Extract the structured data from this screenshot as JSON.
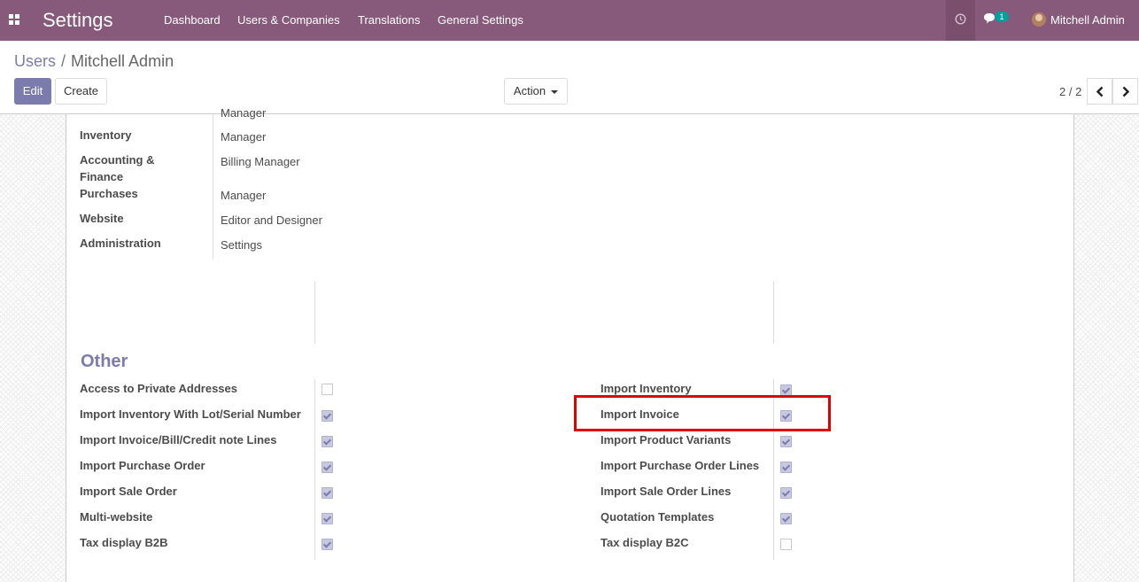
{
  "navbar": {
    "app_title": "Settings",
    "menu": [
      "Dashboard",
      "Users & Companies",
      "Translations",
      "General Settings"
    ],
    "chat_badge": "1",
    "user_name": "Mitchell Admin"
  },
  "control_panel": {
    "breadcrumb_parent": "Users",
    "breadcrumb_sep": "/",
    "breadcrumb_current": "Mitchell Admin",
    "edit_label": "Edit",
    "create_label": "Create",
    "action_label": "Action",
    "pager": "2 / 2"
  },
  "access_rights": {
    "cut_off_value": "Manager",
    "rows": [
      {
        "label": "Inventory",
        "value": "Manager"
      },
      {
        "label": "Accounting & Finance",
        "value": "Billing Manager"
      },
      {
        "label": "Purchases",
        "value": "Manager"
      },
      {
        "label": "Website",
        "value": "Editor and Designer"
      },
      {
        "label": "Administration",
        "value": "Settings"
      }
    ]
  },
  "other": {
    "title": "Other",
    "left": [
      {
        "label": "Access to Private Addresses",
        "checked": false
      },
      {
        "label": "Import Inventory With Lot/Serial Number",
        "checked": true
      },
      {
        "label": "Import Invoice/Bill/Credit note Lines",
        "checked": true
      },
      {
        "label": "Import Purchase Order",
        "checked": true
      },
      {
        "label": "Import Sale Order",
        "checked": true
      },
      {
        "label": "Multi-website",
        "checked": true
      },
      {
        "label": "Tax display B2B",
        "checked": true
      }
    ],
    "right": [
      {
        "label": "Import Inventory",
        "checked": true
      },
      {
        "label": "Import Invoice",
        "checked": true
      },
      {
        "label": "Import Product Variants",
        "checked": true
      },
      {
        "label": "Import Purchase Order Lines",
        "checked": true
      },
      {
        "label": "Import Sale Order Lines",
        "checked": true
      },
      {
        "label": "Quotation Templates",
        "checked": true
      },
      {
        "label": "Tax display B2C",
        "checked": false
      }
    ]
  },
  "colors": {
    "navbar": "#875a7b",
    "primary": "#7c7bad",
    "highlight": "#e00000"
  }
}
